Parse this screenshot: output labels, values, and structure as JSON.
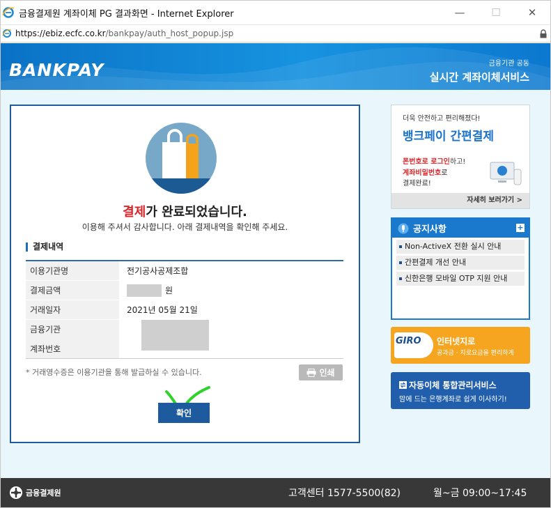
{
  "window": {
    "title": "금융결제원 계좌이체 PG 결과화면 - Internet Explorer",
    "url_host": "https://ebiz.ecfc.co.kr",
    "url_path": "/bankpay/auth_host_popup.jsp",
    "controls": {
      "minimize": "—",
      "maximize": "☐",
      "close": "✕"
    }
  },
  "banner": {
    "logo": "BANKPAY",
    "subtitle": "금융기관 공동",
    "title": "실시간 계좌이체서비스"
  },
  "result": {
    "title_highlight": "결제",
    "title_rest": "가 완료되었습니다.",
    "subtitle": "이용해 주셔서 감사합니다. 아래 결제내역을 확인해 주세요.",
    "section_title": "결제내역",
    "rows": [
      {
        "label": "이용기관명",
        "value": "전기공사공제조합"
      },
      {
        "label": "결제금액",
        "value": "원"
      },
      {
        "label": "거래일자",
        "value": "2021년 05월 21일"
      }
    ],
    "bank_label": "금융기관",
    "account_label": "계좌번호",
    "receipt_note": "* 거래영수증은 이용기관을 통해 발급하실 수 있습니다.",
    "print_label": "인쇄",
    "confirm_label": "확인"
  },
  "ad": {
    "small": "더욱 안전하고 편리해졌다!",
    "big": "뱅크페이 간편결제",
    "line1_red": "폰번호로 로그인",
    "line1_rest": "하고!",
    "line2_red": "계좌비밀번호",
    "line2_rest": "로",
    "line3": "결제완료!",
    "more": "자세히 보러가기 >"
  },
  "notice": {
    "title": "공지사항",
    "plus": "+",
    "items": [
      "Non-ActiveX 전환 실시 안내",
      "간편결제 개선 안내",
      "신한은행 모바일 OTP 지원 안내"
    ]
  },
  "giro": {
    "logo": "GIRO",
    "title": "인터넷지로",
    "sub": "공과금 · 지로요금을 편리하게"
  },
  "auto": {
    "title": "자동이체 통합관리서비스",
    "sub": "맘에 드는 은행계좌로 쉽게 이사하기!"
  },
  "footer": {
    "logo": "금융결제원",
    "cs": "고객센터 1577-5500(82)",
    "hours": "월~금 09:00~17:45"
  },
  "colors": {
    "brand_blue": "#1d5b9e",
    "accent_red": "#d9262a",
    "giro_orange": "#f5a51f",
    "footer_bg": "#383838"
  }
}
